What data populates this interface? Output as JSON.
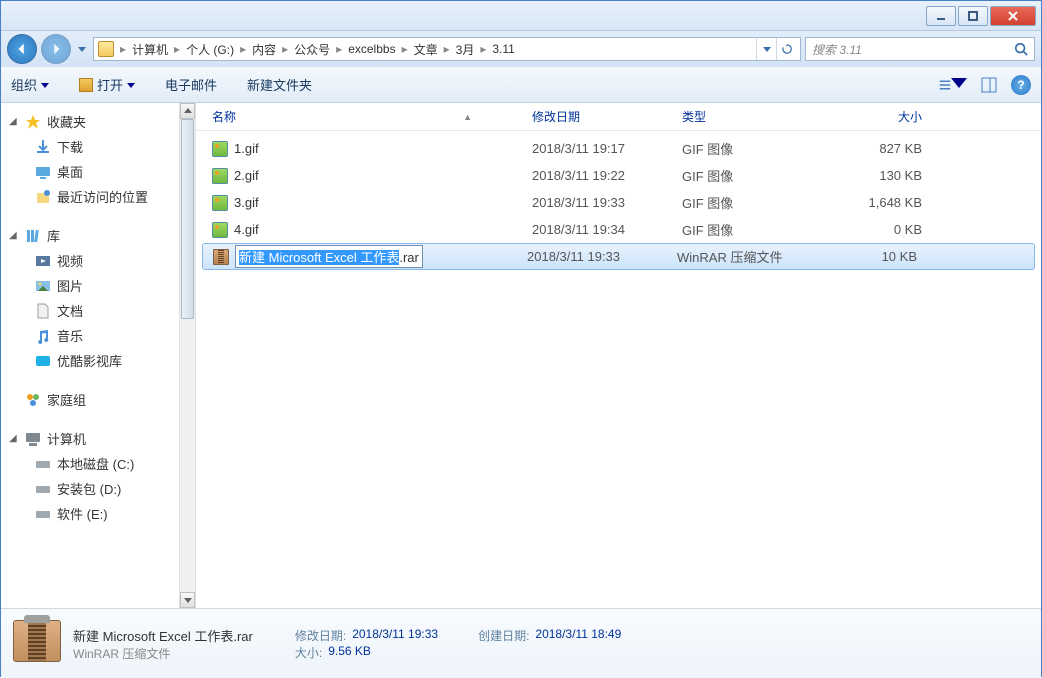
{
  "window": {
    "title": ""
  },
  "breadcrumb": {
    "items": [
      "计算机",
      "个人 (G:)",
      "内容",
      "公众号",
      "excelbbs",
      "文章",
      "3月",
      "3.11"
    ]
  },
  "search": {
    "placeholder": "搜索 3.11"
  },
  "toolbar": {
    "organize": "组织",
    "open": "打开",
    "email": "电子邮件",
    "newfolder": "新建文件夹"
  },
  "sidebar": {
    "favorites": {
      "label": "收藏夹",
      "items": [
        "下载",
        "桌面",
        "最近访问的位置"
      ]
    },
    "libraries": {
      "label": "库",
      "items": [
        "视频",
        "图片",
        "文档",
        "音乐",
        "优酷影视库"
      ]
    },
    "homegroup": {
      "label": "家庭组"
    },
    "computer": {
      "label": "计算机",
      "items": [
        "本地磁盘 (C:)",
        "安装包 (D:)",
        "软件 (E:)"
      ]
    }
  },
  "columns": {
    "name": "名称",
    "date": "修改日期",
    "type": "类型",
    "size": "大小"
  },
  "files": [
    {
      "name": "1.gif",
      "date": "2018/3/11 19:17",
      "type": "GIF 图像",
      "size": "827 KB",
      "icon": "gif"
    },
    {
      "name": "2.gif",
      "date": "2018/3/11 19:22",
      "type": "GIF 图像",
      "size": "130 KB",
      "icon": "gif"
    },
    {
      "name": "3.gif",
      "date": "2018/3/11 19:33",
      "type": "GIF 图像",
      "size": "1,648 KB",
      "icon": "gif"
    },
    {
      "name": "4.gif",
      "date": "2018/3/11 19:34",
      "type": "GIF 图像",
      "size": "0 KB",
      "icon": "gif"
    },
    {
      "name_selected": "新建 Microsoft Excel 工作表",
      "name_ext": ".rar",
      "date": "2018/3/11 19:33",
      "type": "WinRAR 压缩文件",
      "size": "10 KB",
      "icon": "rar",
      "renaming": true
    }
  ],
  "details": {
    "title": "新建 Microsoft Excel 工作表.rar",
    "subtitle": "WinRAR 压缩文件",
    "props": [
      {
        "label": "修改日期:",
        "value": "2018/3/11 19:33"
      },
      {
        "label": "创建日期:",
        "value": "2018/3/11 18:49"
      },
      {
        "label": "大小:",
        "value": "9.56 KB"
      }
    ]
  }
}
